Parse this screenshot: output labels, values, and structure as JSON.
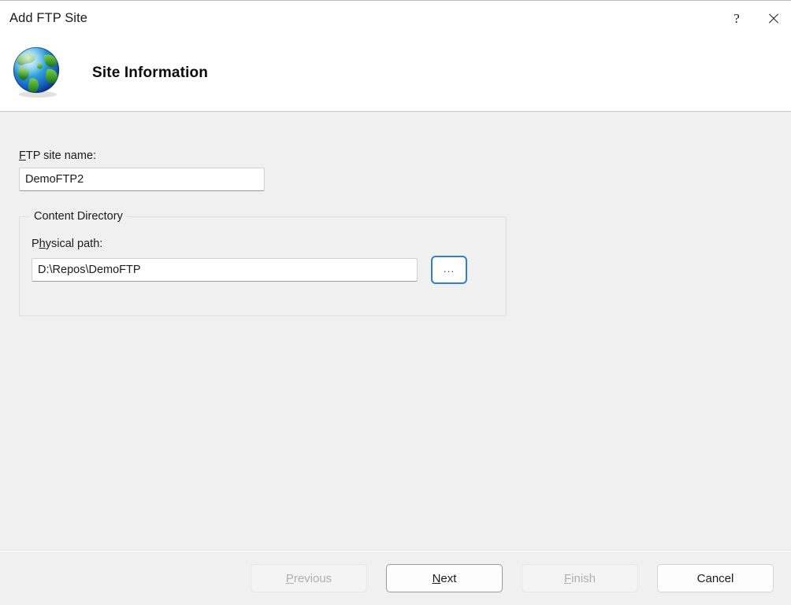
{
  "window": {
    "title": "Add FTP Site",
    "help_button": "?",
    "close_button": "✕"
  },
  "header": {
    "icon": "globe-icon",
    "title": "Site Information"
  },
  "form": {
    "site_name": {
      "label_prefix": "",
      "label_accel": "F",
      "label_suffix": "TP site name:",
      "label_full": "FTP site name:",
      "value": "DemoFTP2"
    },
    "content_directory": {
      "legend": "Content Directory",
      "physical_path": {
        "label_prefix": "P",
        "label_accel": "h",
        "label_suffix": "ysical path:",
        "label_full": "Physical path:",
        "value": "D:\\Repos\\DemoFTP"
      },
      "browse_button": {
        "label": "...",
        "accent_color": "#2f7fd1"
      }
    }
  },
  "footer": {
    "buttons": [
      {
        "name": "previous",
        "prefix": "",
        "accel": "P",
        "suffix": "revious",
        "label": "Previous",
        "state": "disabled"
      },
      {
        "name": "next",
        "prefix": "",
        "accel": "N",
        "suffix": "ext",
        "label": "Next",
        "state": "default"
      },
      {
        "name": "finish",
        "prefix": "",
        "accel": "F",
        "suffix": "inish",
        "label": "Finish",
        "state": "disabled"
      },
      {
        "name": "cancel",
        "prefix": "Cancel",
        "accel": "",
        "suffix": "",
        "label": "Cancel",
        "state": "enabled"
      }
    ]
  },
  "colors": {
    "dialog_background": "#f0f0f0",
    "header_background": "#ffffff",
    "accent": "#2f7fd1",
    "text": "#1b1b1b",
    "disabled_text": "#b0aeae"
  }
}
